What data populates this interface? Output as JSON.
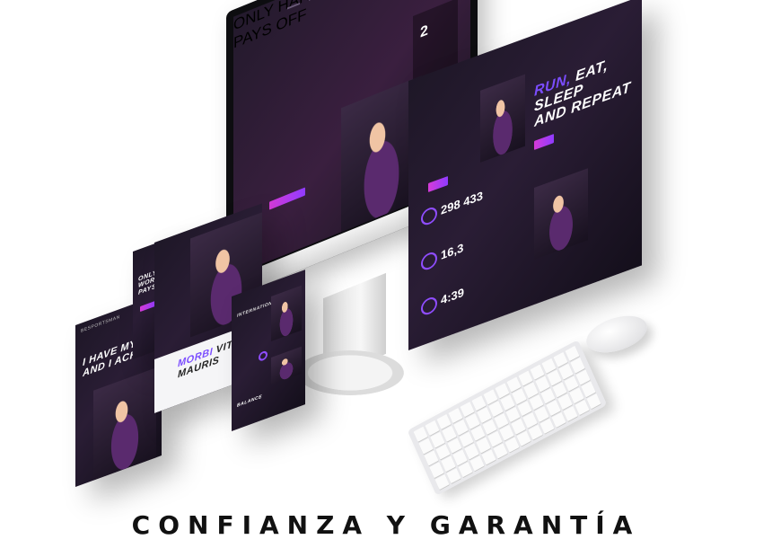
{
  "caption": "CONFIANZA Y GARANTÍA",
  "monitor": {
    "headline_line1": "ONLY HARD WORK",
    "headline_line2": "PAYS OFF",
    "side_number": "2"
  },
  "right_panel": {
    "headline_accent": "RUN,",
    "headline_rest1": "EAT, SLEEP",
    "headline_rest2": "AND REPEAT",
    "stats": [
      {
        "value": "298 433"
      },
      {
        "value": "16,3"
      },
      {
        "value": "4:39"
      }
    ]
  },
  "left_panel": {
    "brand": "BESPORTSMAN",
    "headline_line1": "I HAVE MY",
    "headline_line2": "AND I ACH"
  },
  "small_phone": {
    "headline_line1": "ONLY HARD",
    "headline_line2": "WORK",
    "headline_line3": "PAYS OFF"
  },
  "middle_panel": {
    "accent_word": "MORBI",
    "word2": "VITA",
    "word3": "MAURIS"
  },
  "phone_front": {
    "headline_line1": "INTERNATIONAL SPORTS",
    "bottom_label": "BALANCE"
  }
}
